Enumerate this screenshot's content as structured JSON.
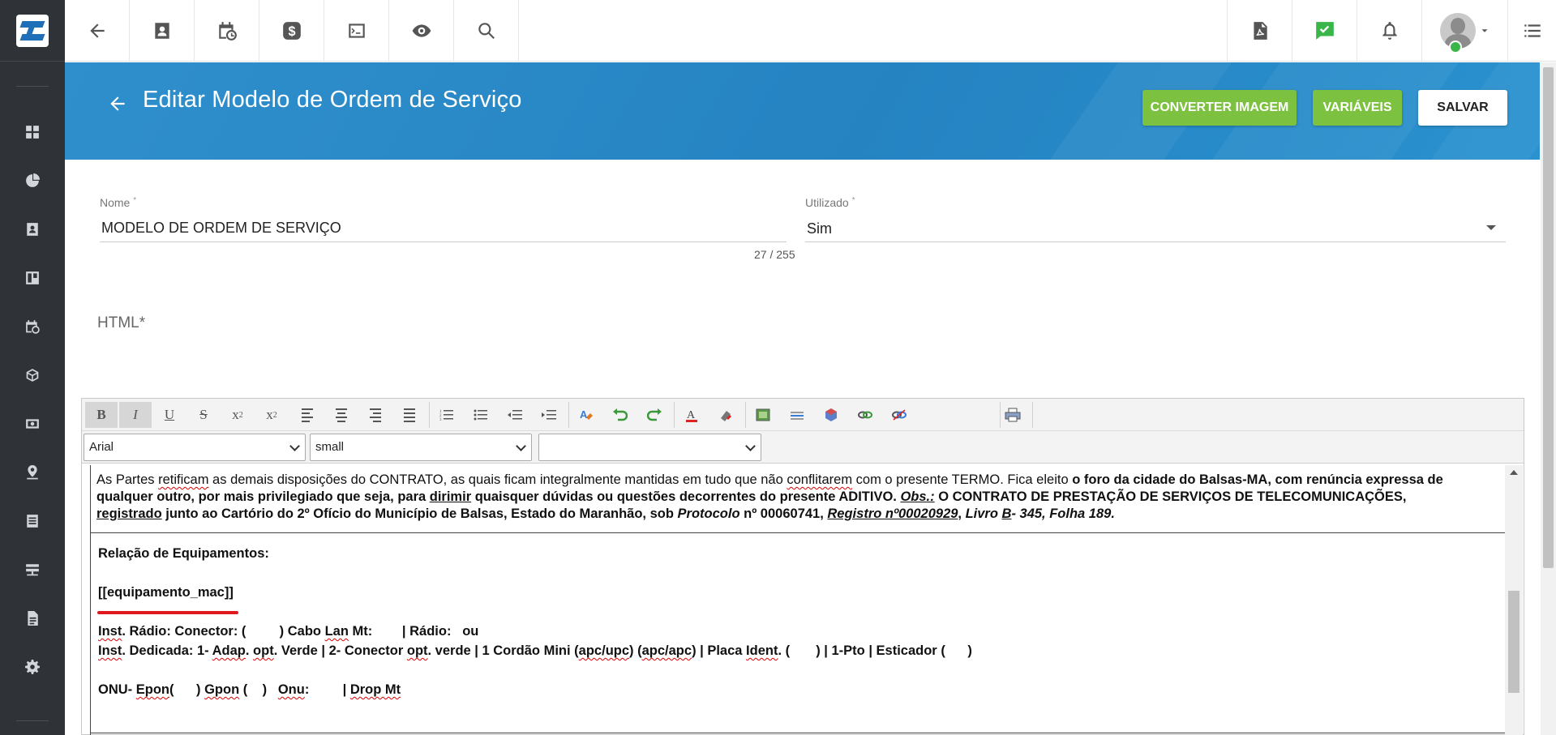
{
  "header": {
    "title": "Editar Modelo de Ordem de Serviço",
    "buttons": {
      "convert_image": "CONVERTER IMAGEM",
      "variables": "VARIÁVEIS",
      "save": "SALVAR"
    }
  },
  "form": {
    "name": {
      "label": "Nome",
      "required_mark": "*",
      "value": "MODELO DE ORDEM DE SERVIÇO",
      "counter": "27 / 255"
    },
    "used": {
      "label": "Utilizado",
      "required_mark": "*",
      "value": "Sim"
    },
    "html_label": "HTML*"
  },
  "editor": {
    "font_family": "Arial",
    "font_size": "small",
    "format": "",
    "content": {
      "para_start": "As Partes ",
      "w_retificam": "retificam",
      "para_mid1": " as demais disposições do CONTRATO, as quais ficam integralmente mantidas em tudo que não ",
      "w_conflitarem": "conflitarem",
      "para_mid2": " com o presente TERMO. Fica eleito ",
      "para_bold1": "o foro da cidade do Balsas-MA, com renúncia expressa de qualquer outro, por mais privilegiado que seja, para ",
      "w_dirimir": "dirimir",
      "para_bold2": " quaisquer dúvidas ou questões decorrentes do presente ADITIVO. ",
      "obs": "Obs.:",
      "para_bold3": " O CONTRATO DE PRESTAÇÃO DE SERVIÇOS DE TELECOMUNICAÇÕES, ",
      "w_registrado": "registrado",
      "para_bold4": " junto ao Cartório do 2º Ofício do Município de Balsas, Estado do Maranhão, sob ",
      "protocolo": "Protocolo",
      "para_bold5": " nº 00060741, ",
      "registro": "Registro nº00020929",
      "para_bold6": ", ",
      "livro": "Livro ",
      "w_b": "B",
      "livro_rest": "- 345, Folha 189.",
      "relacao": "Relação de Equipamentos:",
      "variable": "[[equipamento_mac]]",
      "inst_radio_1": "Inst",
      "inst_radio_2": ". Rádio: Conector: (         ) Cabo ",
      "inst_radio_lan": "Lan",
      "inst_radio_3": " Mt:        | Rádio:   ou",
      "inst_ded_1": "Inst",
      "inst_ded_2": ". Dedicada: 1- ",
      "inst_ded_adap": "Adap",
      "inst_ded_3": ". ",
      "inst_ded_opt1": "opt",
      "inst_ded_4": ". Verde | 2- Conector ",
      "inst_ded_opt2": "opt",
      "inst_ded_5": ". verde | 1 Cordão Mini (",
      "inst_ded_apc1": "apc/upc",
      "inst_ded_6": ") (",
      "inst_ded_apc2": "apc/apc",
      "inst_ded_7": ") | Placa ",
      "inst_ded_ident": "Ident",
      "inst_ded_8": ". (       ) | 1-Pto | Esticador (      )",
      "onu_1": "ONU- ",
      "onu_epon": "Epon",
      "onu_2": "(      ) ",
      "onu_gpon": "Gpon",
      "onu_3": " (    )   ",
      "onu_onu": "Onu",
      "onu_4": ":         | ",
      "onu_drop": "Drop Mt"
    }
  },
  "icons": {
    "sidebar": [
      "dashboard-icon",
      "chart-pie-icon",
      "contact-card-icon",
      "board-icon",
      "calendar-clock-icon",
      "box-icon",
      "money-icon",
      "location-icon",
      "list-icon",
      "server-icon",
      "document-icon",
      "gear-icon"
    ],
    "topbar": [
      "back-arrow-icon",
      "contact-card-icon",
      "calendar-clock-icon",
      "dollar-icon",
      "terminal-icon",
      "eye-icon",
      "search-icon",
      "pdf-icon",
      "check-chat-icon",
      "bell-icon",
      "avatar",
      "menu-list-icon"
    ]
  },
  "colors": {
    "sidebar": "#2f3338",
    "banner": "#2583c2",
    "green_button": "#7cc13f",
    "status_online": "#39b54a",
    "annotation_red": "#e0191e"
  }
}
